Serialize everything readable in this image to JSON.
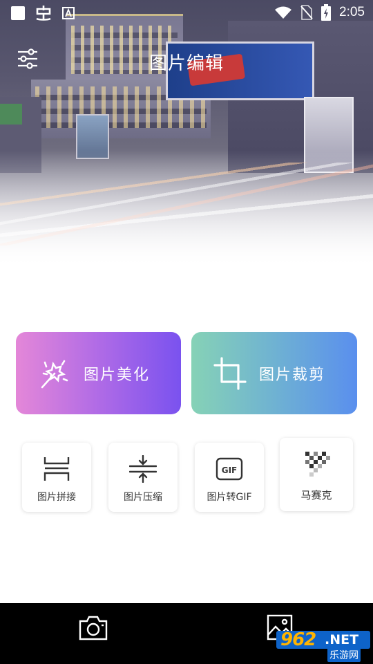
{
  "status_bar": {
    "time": "2:05",
    "left_icons": [
      "square-icon",
      "bug-icon",
      "a-badge-icon"
    ],
    "right_icons": [
      "wifi-icon",
      "no-sim-icon",
      "battery-charging-icon"
    ]
  },
  "header": {
    "title": "图片编辑",
    "menu_icon": "sliders-icon"
  },
  "features": [
    {
      "label": "图片美化",
      "icon": "magic-wand-icon",
      "colors": [
        "#e487d8",
        "#7a52ef"
      ]
    },
    {
      "label": "图片裁剪",
      "icon": "crop-icon",
      "colors": [
        "#86d2b6",
        "#5a8fee"
      ]
    }
  ],
  "tools": [
    {
      "label": "图片拼接",
      "icon": "stitch-icon"
    },
    {
      "label": "图片压缩",
      "icon": "compress-icon"
    },
    {
      "label": "图片转GIF",
      "icon": "gif-icon",
      "icon_text": "GIF"
    },
    {
      "label": "马赛克",
      "icon": "mosaic-icon"
    }
  ],
  "bottom_nav": [
    {
      "icon": "camera-icon"
    },
    {
      "icon": "gallery-icon"
    }
  ],
  "watermark": {
    "number": "962",
    "suffix": ".NET",
    "subtitle": "乐游网"
  }
}
